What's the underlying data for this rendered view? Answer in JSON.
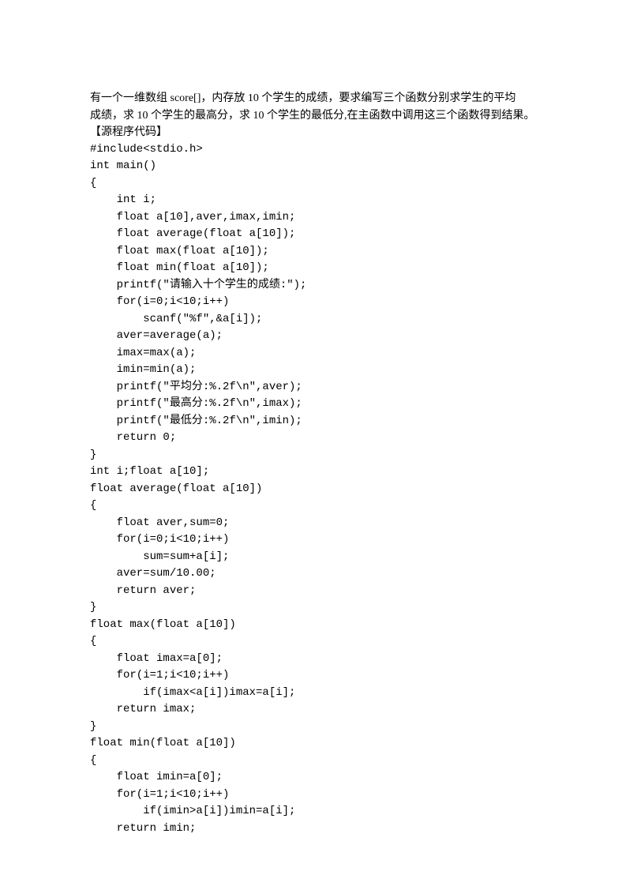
{
  "problem": {
    "line1": "有一个一维数组 score[]，内存放 10 个学生的成绩，要求编写三个函数分别求学生的平均",
    "line2": "成绩，求 10 个学生的最高分，求 10 个学生的最低分,在主函数中调用这三个函数得到结果。",
    "label": "【源程序代码】"
  },
  "code": [
    "#include<stdio.h>",
    "int main()",
    "{",
    "    int i;",
    "    float a[10],aver,imax,imin;",
    "    float average(float a[10]);",
    "    float max(float a[10]);",
    "    float min(float a[10]);",
    "    printf(\"请输入十个学生的成绩:\");",
    "    for(i=0;i<10;i++)",
    "        scanf(\"%f\",&a[i]);",
    "    aver=average(a);",
    "    imax=max(a);",
    "    imin=min(a);",
    "    printf(\"平均分:%.2f\\n\",aver);",
    "    printf(\"最高分:%.2f\\n\",imax);",
    "    printf(\"最低分:%.2f\\n\",imin);",
    "    return 0;",
    "}",
    "int i;float a[10];",
    "float average(float a[10])",
    "{",
    "    float aver,sum=0;",
    "    for(i=0;i<10;i++)",
    "        sum=sum+a[i];",
    "    aver=sum/10.00;",
    "    return aver;",
    "}",
    "float max(float a[10])",
    "{",
    "    float imax=a[0];",
    "    for(i=1;i<10;i++)",
    "        if(imax<a[i])imax=a[i];",
    "    return imax;",
    "}",
    "float min(float a[10])",
    "{",
    "    float imin=a[0];",
    "    for(i=1;i<10;i++)",
    "        if(imin>a[i])imin=a[i];",
    "    return imin;"
  ]
}
